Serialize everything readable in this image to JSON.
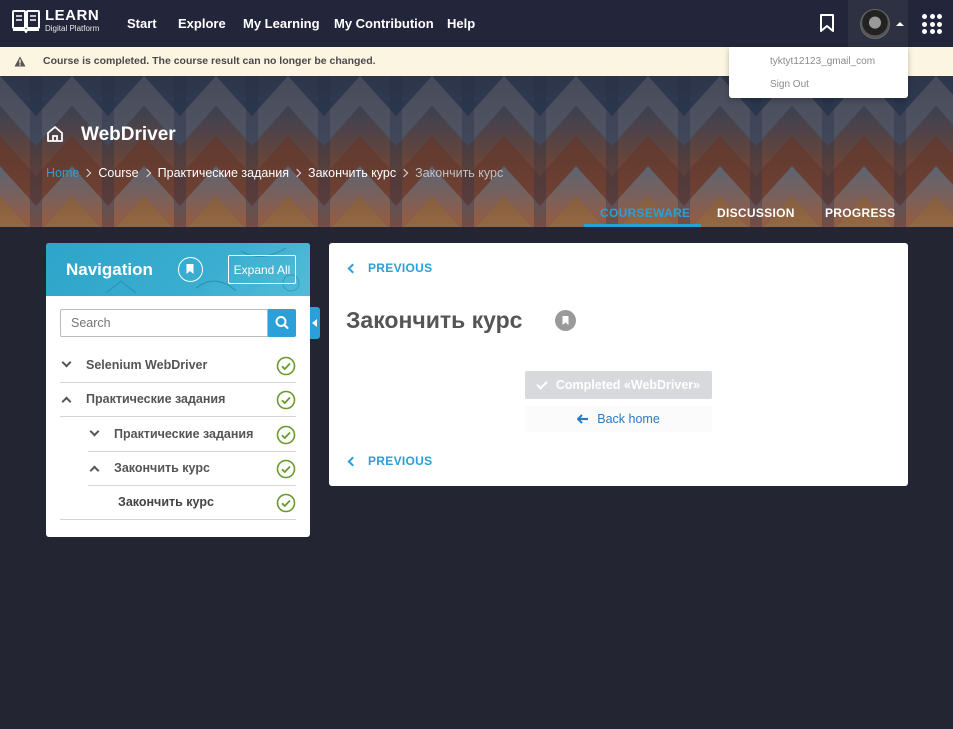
{
  "brand": {
    "title": "LEARN",
    "subtitle": "Digital Platform"
  },
  "topnav": {
    "items": [
      "Start",
      "Explore",
      "My Learning",
      "My Contribution",
      "Help"
    ]
  },
  "user_menu": {
    "username": "tyktyt12123_gmail_com",
    "sign_out": "Sign Out"
  },
  "alert": {
    "message": "Course is completed. The course result can no longer be changed."
  },
  "course": {
    "title": "WebDriver",
    "breadcrumb": [
      "Home",
      "Course",
      "Практические задания",
      "Закончить курс",
      "Закончить курс"
    ],
    "tabs": [
      "COURSEWARE",
      "DISCUSSION",
      "PROGRESS"
    ],
    "active_tab": "COURSEWARE"
  },
  "navigation": {
    "title": "Navigation",
    "expand_all": "Expand All",
    "search_placeholder": "Search",
    "items": [
      {
        "label": "Selenium WebDriver",
        "level": 0,
        "state": "collapsed",
        "completed": true
      },
      {
        "label": "Практические задания",
        "level": 0,
        "state": "expanded",
        "completed": true
      },
      {
        "label": "Практические задания",
        "level": 1,
        "state": "collapsed",
        "completed": true
      },
      {
        "label": "Закончить курс",
        "level": 1,
        "state": "expanded",
        "completed": true
      },
      {
        "label": "Закончить курс",
        "level": 2,
        "state": "leaf",
        "completed": true
      }
    ]
  },
  "unit": {
    "previous_label": "PREVIOUS",
    "title": "Закончить курс",
    "completed_label": "Completed «WebDriver»",
    "back_home_label": "Back home"
  },
  "colors": {
    "accent": "#2a9fd8",
    "topbar": "#23263a",
    "page_bg": "#232532",
    "check": "#6a9a2e"
  }
}
